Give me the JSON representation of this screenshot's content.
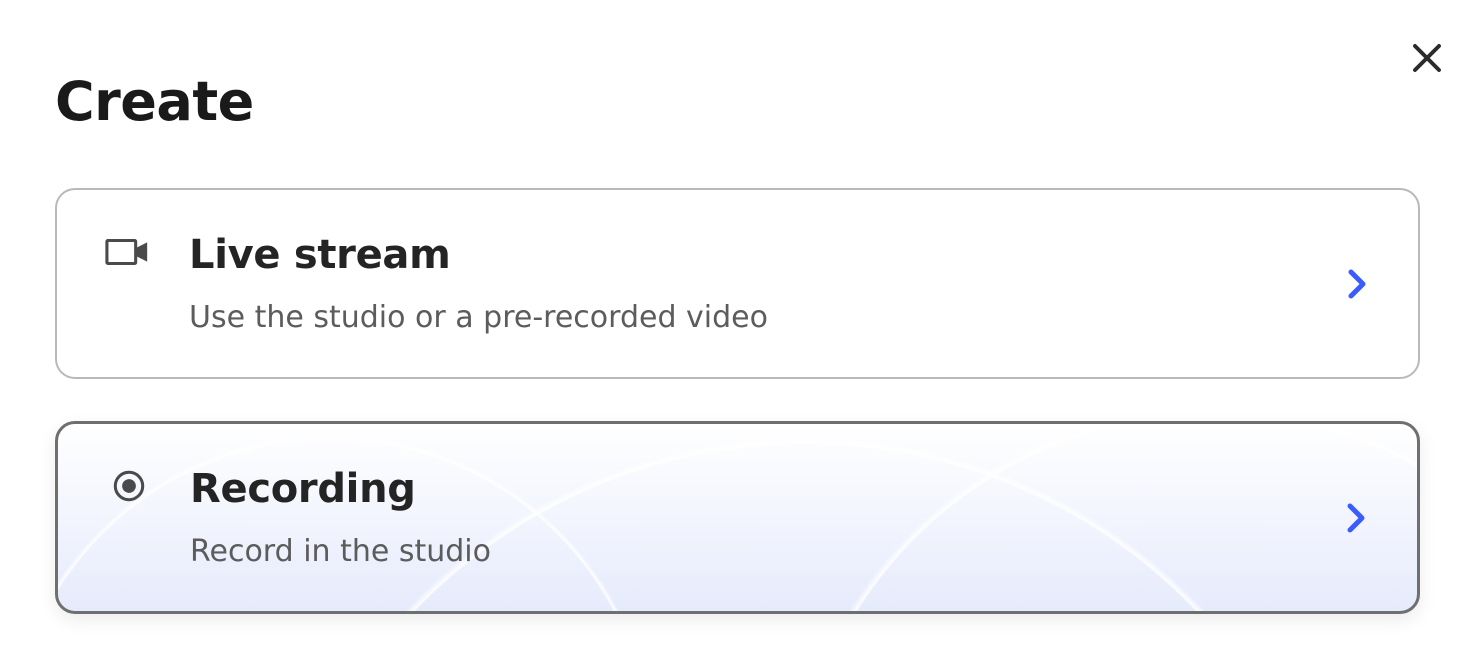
{
  "header": {
    "title": "Create"
  },
  "options": {
    "live_stream": {
      "title": "Live stream",
      "description": "Use the studio or a pre-recorded video"
    },
    "recording": {
      "title": "Recording",
      "description": "Record in the studio"
    }
  }
}
